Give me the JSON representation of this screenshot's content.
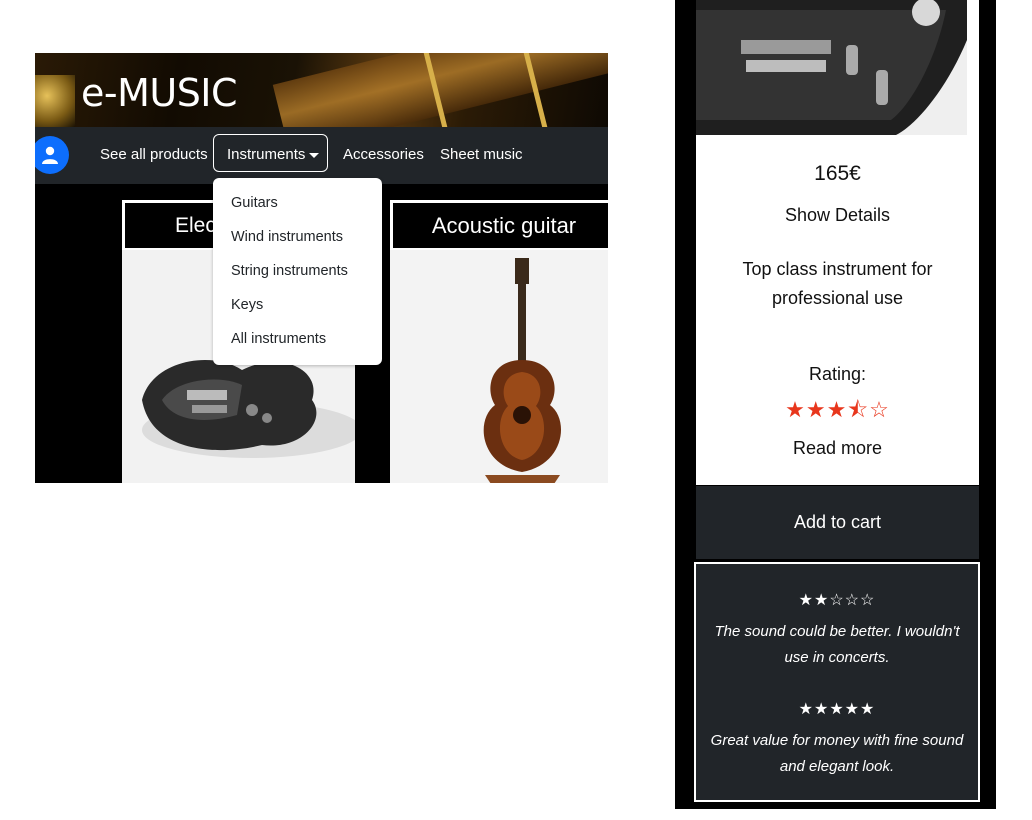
{
  "app": {
    "logo": "e-MUSIC"
  },
  "nav": {
    "see_all": "See all products",
    "instruments": "Instruments",
    "accessories": "Accessories",
    "sheet_music": "Sheet music"
  },
  "dropdown": {
    "items": [
      "Guitars",
      "Wind instruments",
      "String instruments",
      "Keys",
      "All instruments"
    ]
  },
  "cards": [
    {
      "title": "Elec"
    },
    {
      "title": "Acoustic guitar"
    }
  ],
  "product": {
    "price": "165€",
    "show_details": "Show Details",
    "description": "Top class instrument for professional use",
    "rating_label": "Rating:",
    "rating_stars": "★★★⯪☆",
    "rating_value": 3.5,
    "read_more": "Read more",
    "add_to_cart": "Add to cart"
  },
  "reviews": [
    {
      "stars": "★★☆☆☆",
      "rating": 2,
      "text": "The sound could be better. I wouldn't use in concerts."
    },
    {
      "stars": "★★★★★",
      "rating": 5,
      "text": "Great value for money with fine sound and elegant look."
    }
  ],
  "colors": {
    "accent": "#0d6efd",
    "navbar": "#212529",
    "star": "#e8361c"
  }
}
